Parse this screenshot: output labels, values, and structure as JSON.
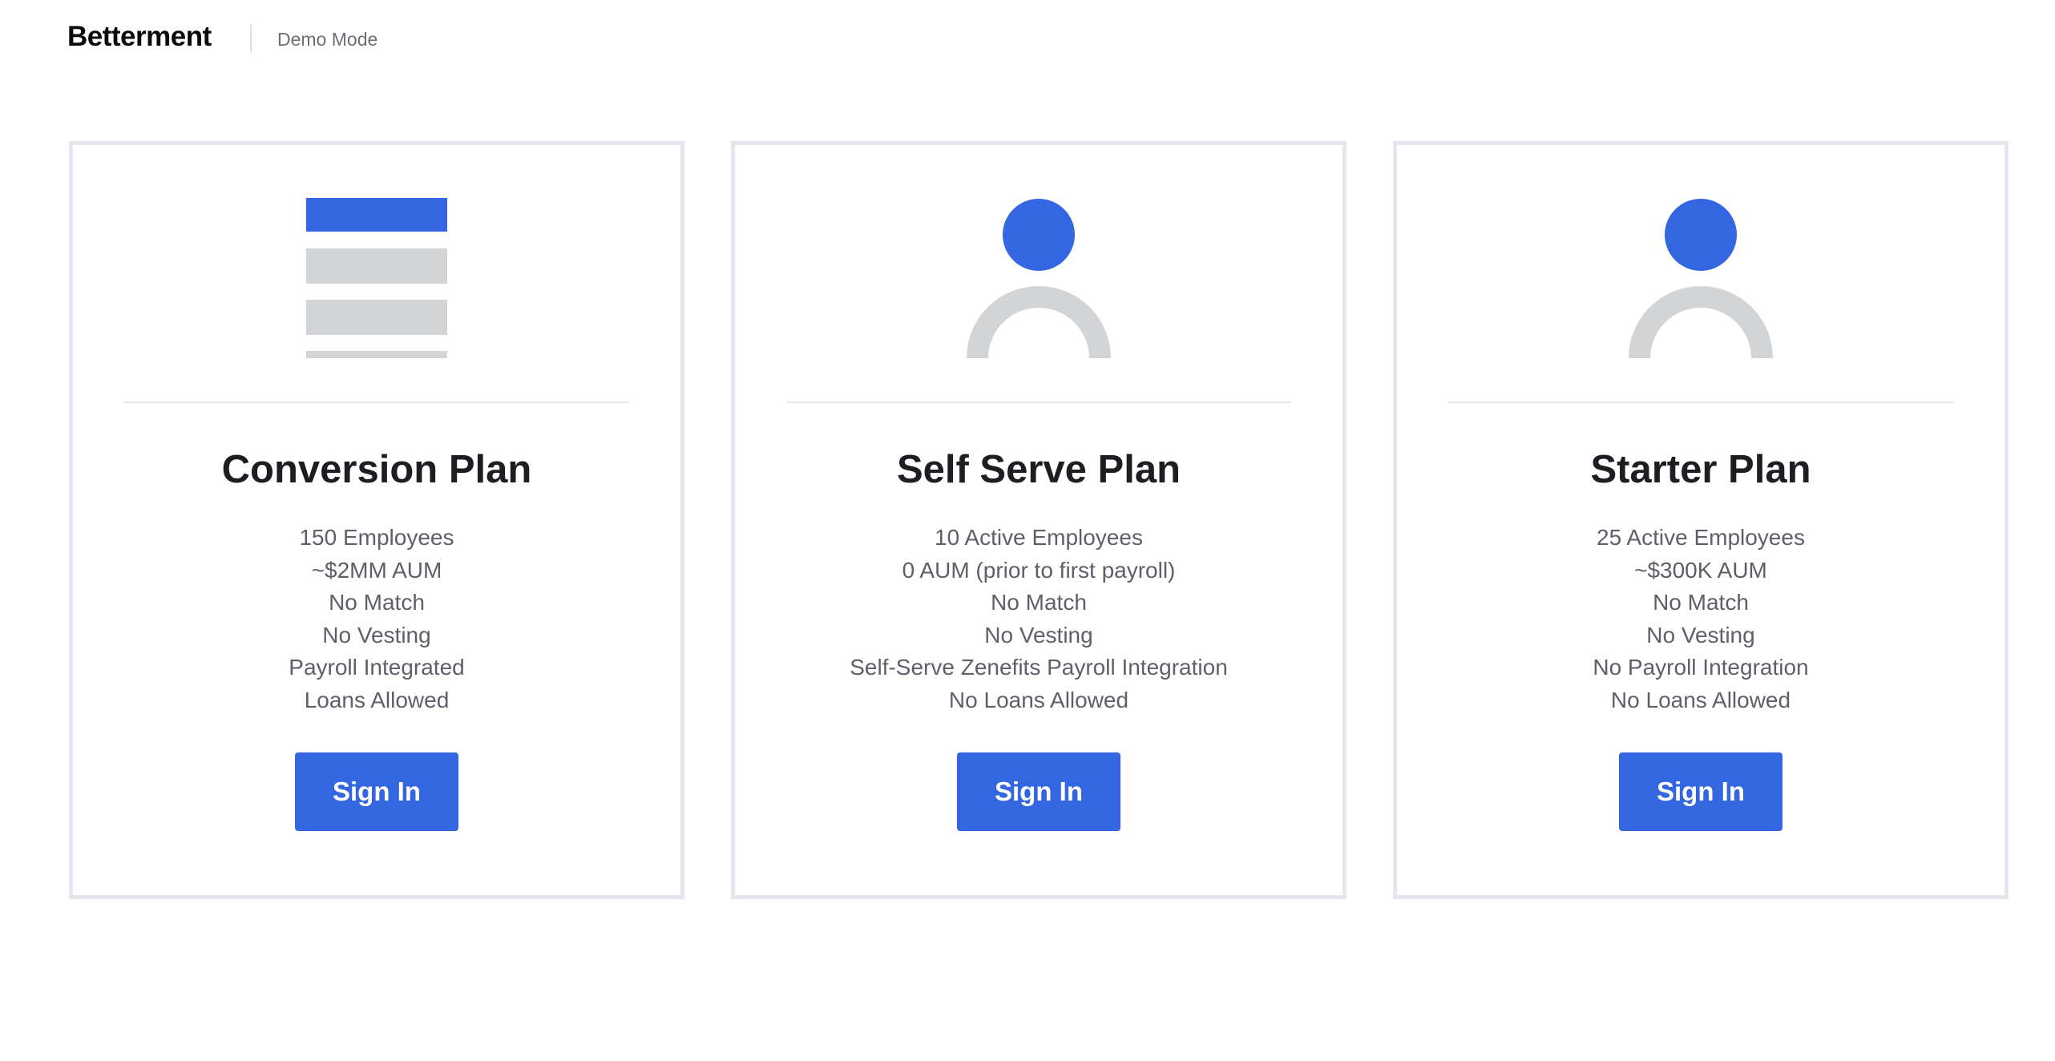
{
  "header": {
    "brand": "Betterment",
    "mode": "Demo Mode"
  },
  "colors": {
    "accent": "#3366e0",
    "illustration_gray": "#d3d4d6",
    "card_border": "#e4e6ee"
  },
  "plans": [
    {
      "icon": "document-lines-icon",
      "title": "Conversion Plan",
      "features": [
        "150 Employees",
        "~$2MM AUM",
        "No Match",
        "No Vesting",
        "Payroll Integrated",
        "Loans Allowed"
      ],
      "button_label": "Sign In"
    },
    {
      "icon": "person-icon",
      "title": "Self Serve Plan",
      "features": [
        "10 Active Employees",
        "0 AUM (prior to first payroll)",
        "No Match",
        "No Vesting",
        "Self-Serve Zenefits Payroll Integration",
        "No Loans Allowed"
      ],
      "button_label": "Sign In"
    },
    {
      "icon": "person-icon",
      "title": "Starter Plan",
      "features": [
        "25 Active Employees",
        "~$300K AUM",
        "No Match",
        "No Vesting",
        "No Payroll Integration",
        "No Loans Allowed"
      ],
      "button_label": "Sign In"
    }
  ]
}
